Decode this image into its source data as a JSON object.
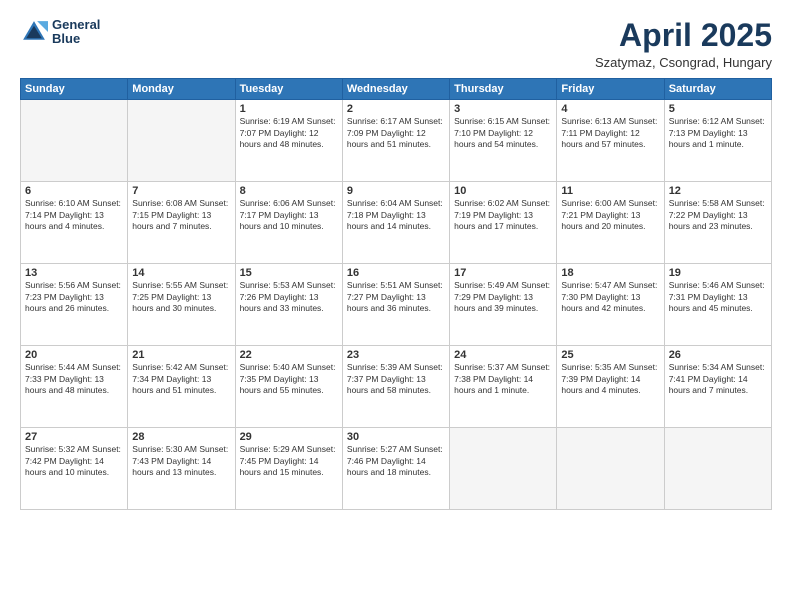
{
  "header": {
    "logo_line1": "General",
    "logo_line2": "Blue",
    "title": "April 2025",
    "subtitle": "Szatymaz, Csongrad, Hungary"
  },
  "weekdays": [
    "Sunday",
    "Monday",
    "Tuesday",
    "Wednesday",
    "Thursday",
    "Friday",
    "Saturday"
  ],
  "weeks": [
    [
      {
        "day": "",
        "info": ""
      },
      {
        "day": "",
        "info": ""
      },
      {
        "day": "1",
        "info": "Sunrise: 6:19 AM\nSunset: 7:07 PM\nDaylight: 12 hours\nand 48 minutes."
      },
      {
        "day": "2",
        "info": "Sunrise: 6:17 AM\nSunset: 7:09 PM\nDaylight: 12 hours\nand 51 minutes."
      },
      {
        "day": "3",
        "info": "Sunrise: 6:15 AM\nSunset: 7:10 PM\nDaylight: 12 hours\nand 54 minutes."
      },
      {
        "day": "4",
        "info": "Sunrise: 6:13 AM\nSunset: 7:11 PM\nDaylight: 12 hours\nand 57 minutes."
      },
      {
        "day": "5",
        "info": "Sunrise: 6:12 AM\nSunset: 7:13 PM\nDaylight: 13 hours\nand 1 minute."
      }
    ],
    [
      {
        "day": "6",
        "info": "Sunrise: 6:10 AM\nSunset: 7:14 PM\nDaylight: 13 hours\nand 4 minutes."
      },
      {
        "day": "7",
        "info": "Sunrise: 6:08 AM\nSunset: 7:15 PM\nDaylight: 13 hours\nand 7 minutes."
      },
      {
        "day": "8",
        "info": "Sunrise: 6:06 AM\nSunset: 7:17 PM\nDaylight: 13 hours\nand 10 minutes."
      },
      {
        "day": "9",
        "info": "Sunrise: 6:04 AM\nSunset: 7:18 PM\nDaylight: 13 hours\nand 14 minutes."
      },
      {
        "day": "10",
        "info": "Sunrise: 6:02 AM\nSunset: 7:19 PM\nDaylight: 13 hours\nand 17 minutes."
      },
      {
        "day": "11",
        "info": "Sunrise: 6:00 AM\nSunset: 7:21 PM\nDaylight: 13 hours\nand 20 minutes."
      },
      {
        "day": "12",
        "info": "Sunrise: 5:58 AM\nSunset: 7:22 PM\nDaylight: 13 hours\nand 23 minutes."
      }
    ],
    [
      {
        "day": "13",
        "info": "Sunrise: 5:56 AM\nSunset: 7:23 PM\nDaylight: 13 hours\nand 26 minutes."
      },
      {
        "day": "14",
        "info": "Sunrise: 5:55 AM\nSunset: 7:25 PM\nDaylight: 13 hours\nand 30 minutes."
      },
      {
        "day": "15",
        "info": "Sunrise: 5:53 AM\nSunset: 7:26 PM\nDaylight: 13 hours\nand 33 minutes."
      },
      {
        "day": "16",
        "info": "Sunrise: 5:51 AM\nSunset: 7:27 PM\nDaylight: 13 hours\nand 36 minutes."
      },
      {
        "day": "17",
        "info": "Sunrise: 5:49 AM\nSunset: 7:29 PM\nDaylight: 13 hours\nand 39 minutes."
      },
      {
        "day": "18",
        "info": "Sunrise: 5:47 AM\nSunset: 7:30 PM\nDaylight: 13 hours\nand 42 minutes."
      },
      {
        "day": "19",
        "info": "Sunrise: 5:46 AM\nSunset: 7:31 PM\nDaylight: 13 hours\nand 45 minutes."
      }
    ],
    [
      {
        "day": "20",
        "info": "Sunrise: 5:44 AM\nSunset: 7:33 PM\nDaylight: 13 hours\nand 48 minutes."
      },
      {
        "day": "21",
        "info": "Sunrise: 5:42 AM\nSunset: 7:34 PM\nDaylight: 13 hours\nand 51 minutes."
      },
      {
        "day": "22",
        "info": "Sunrise: 5:40 AM\nSunset: 7:35 PM\nDaylight: 13 hours\nand 55 minutes."
      },
      {
        "day": "23",
        "info": "Sunrise: 5:39 AM\nSunset: 7:37 PM\nDaylight: 13 hours\nand 58 minutes."
      },
      {
        "day": "24",
        "info": "Sunrise: 5:37 AM\nSunset: 7:38 PM\nDaylight: 14 hours\nand 1 minute."
      },
      {
        "day": "25",
        "info": "Sunrise: 5:35 AM\nSunset: 7:39 PM\nDaylight: 14 hours\nand 4 minutes."
      },
      {
        "day": "26",
        "info": "Sunrise: 5:34 AM\nSunset: 7:41 PM\nDaylight: 14 hours\nand 7 minutes."
      }
    ],
    [
      {
        "day": "27",
        "info": "Sunrise: 5:32 AM\nSunset: 7:42 PM\nDaylight: 14 hours\nand 10 minutes."
      },
      {
        "day": "28",
        "info": "Sunrise: 5:30 AM\nSunset: 7:43 PM\nDaylight: 14 hours\nand 13 minutes."
      },
      {
        "day": "29",
        "info": "Sunrise: 5:29 AM\nSunset: 7:45 PM\nDaylight: 14 hours\nand 15 minutes."
      },
      {
        "day": "30",
        "info": "Sunrise: 5:27 AM\nSunset: 7:46 PM\nDaylight: 14 hours\nand 18 minutes."
      },
      {
        "day": "",
        "info": ""
      },
      {
        "day": "",
        "info": ""
      },
      {
        "day": "",
        "info": ""
      }
    ]
  ]
}
